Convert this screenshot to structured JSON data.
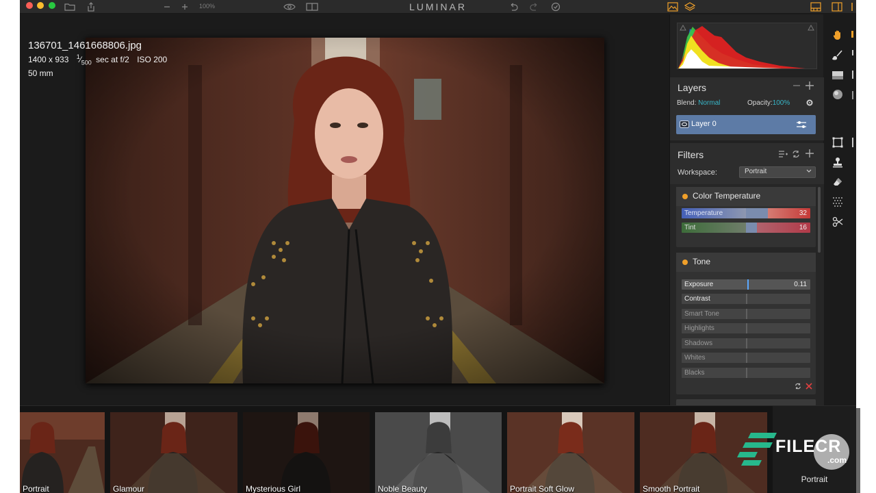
{
  "app": {
    "title": "LUMINAR"
  },
  "colors": {
    "accent": "#38b6c8",
    "layer_selected": "#5d7ba6",
    "filter_dot": "#f0a02a",
    "toolbar_accent": "#f0a02a"
  },
  "toolbar": {
    "zoom_level": "100%",
    "icons": [
      "folder-icon",
      "share-icon",
      "zoom-out-icon",
      "zoom-in-icon",
      "eye-icon",
      "compare-icon",
      "undo-icon",
      "redo-icon",
      "history-icon",
      "presets-icon",
      "layers-icon",
      "filmstrip-icon",
      "side-panel-icon"
    ]
  },
  "image": {
    "filename": "136701_1461668806.jpg",
    "dimensions": "1400 x 933",
    "shutter_numerator": "1",
    "shutter_denominator": "500",
    "shutter_rest": "sec at f/2",
    "iso": "ISO 200",
    "focal_length": "50 mm"
  },
  "layers": {
    "title": "Layers",
    "blend_label": "Blend:",
    "blend_value": "Normal",
    "opacity_label": "Opacity:",
    "opacity_value": "100%",
    "items": [
      {
        "name": "Layer 0"
      }
    ]
  },
  "filters": {
    "title": "Filters",
    "workspace_label": "Workspace:",
    "workspace_value": "Portrait",
    "cards": [
      {
        "title": "Color Temperature",
        "sliders": [
          {
            "label": "Temperature",
            "value": "32"
          },
          {
            "label": "Tint",
            "value": "16"
          }
        ]
      },
      {
        "title": "Tone",
        "sliders": [
          {
            "label": "Exposure",
            "value": "0.11"
          },
          {
            "label": "Contrast",
            "value": ""
          },
          {
            "label": "Smart Tone",
            "value": ""
          },
          {
            "label": "Highlights",
            "value": ""
          },
          {
            "label": "Shadows",
            "value": ""
          },
          {
            "label": "Whites",
            "value": ""
          },
          {
            "label": "Blacks",
            "value": ""
          }
        ]
      }
    ]
  },
  "tools": [
    "hand-icon",
    "brush-icon",
    "gradient-icon",
    "radial-icon",
    "crop-icon",
    "clone-stamp-icon",
    "eraser-icon",
    "noise-icon",
    "transform-icon"
  ],
  "presets": {
    "items": [
      {
        "name": "Portrait"
      },
      {
        "name": "Glamour"
      },
      {
        "name": "Mysterious Girl"
      },
      {
        "name": "Noble Beauty"
      },
      {
        "name": "Portrait Soft Glow"
      },
      {
        "name": "Smooth Portrait"
      }
    ],
    "category": "Portrait"
  },
  "watermark": {
    "text": "FILECR",
    "suffix": ".com"
  }
}
